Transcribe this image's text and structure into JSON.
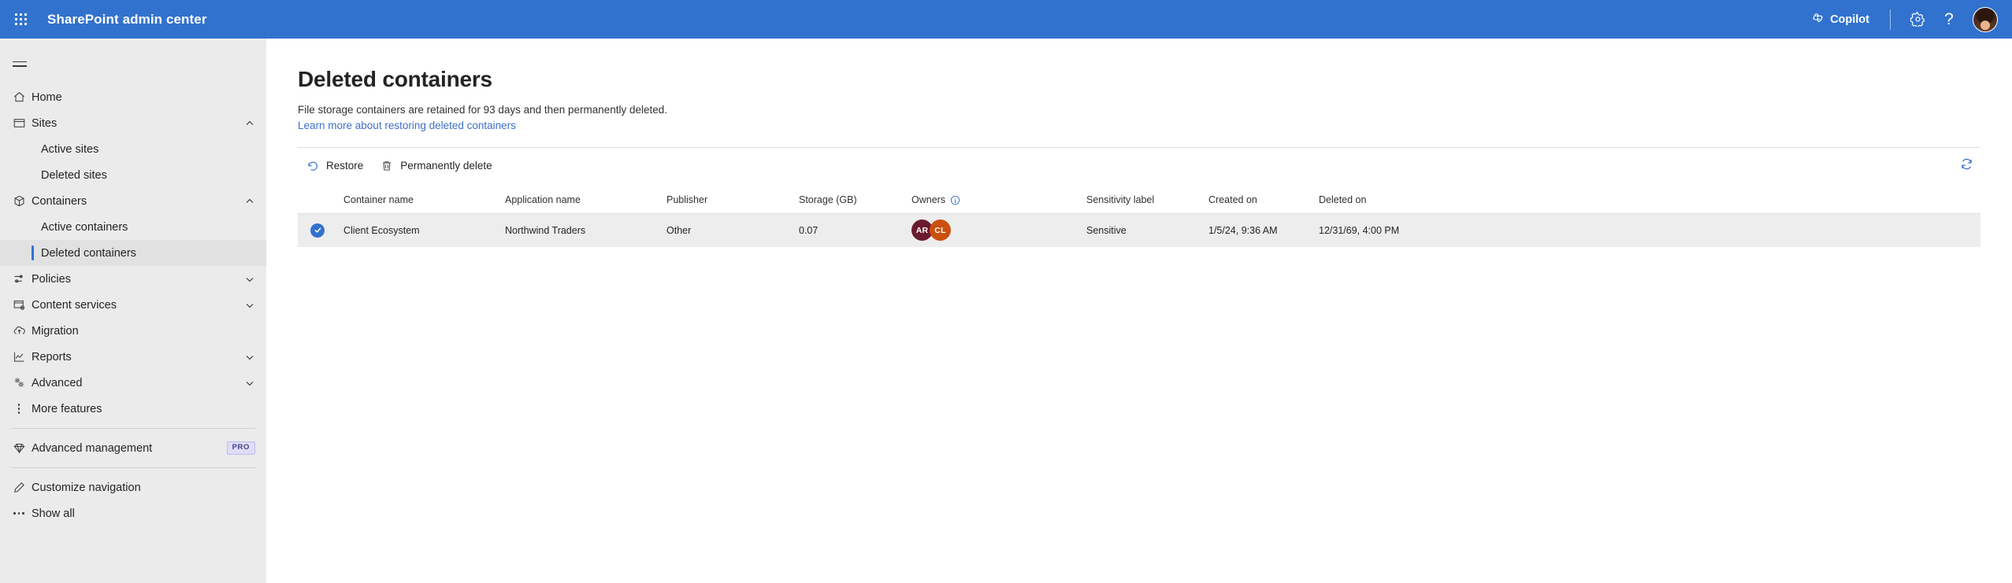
{
  "topbar": {
    "waffle_icon": "app-launcher-icon",
    "brand": "SharePoint admin center",
    "copilot_label": "Copilot",
    "copilot_icon": "copilot-icon",
    "settings_icon": "gear-icon",
    "help_icon": "question-mark-icon",
    "help_glyph": "?",
    "avatar_icon": "user-avatar",
    "accent_color": "#3172ce"
  },
  "sidebar": {
    "menu_icon": "hamburger-menu-icon",
    "items": [
      {
        "label": "Home",
        "icon": "home-icon",
        "type": "item",
        "expandable": false
      },
      {
        "label": "Sites",
        "icon": "sites-icon",
        "type": "item",
        "expandable": true,
        "expanded": true,
        "chevron": "chevron-up-icon"
      },
      {
        "label": "Active sites",
        "type": "sub",
        "selected": false
      },
      {
        "label": "Deleted sites",
        "type": "sub",
        "selected": false
      },
      {
        "label": "Containers",
        "icon": "container-box-icon",
        "type": "item",
        "expandable": true,
        "expanded": true,
        "chevron": "chevron-up-icon"
      },
      {
        "label": "Active containers",
        "type": "sub",
        "selected": false
      },
      {
        "label": "Deleted containers",
        "type": "sub",
        "selected": true
      },
      {
        "label": "Policies",
        "icon": "sliders-icon",
        "type": "item",
        "expandable": true,
        "expanded": false,
        "chevron": "chevron-down-icon"
      },
      {
        "label": "Content services",
        "icon": "content-services-icon",
        "type": "item",
        "expandable": true,
        "expanded": false,
        "chevron": "chevron-down-icon"
      },
      {
        "label": "Migration",
        "icon": "cloud-upload-icon",
        "type": "item",
        "expandable": false
      },
      {
        "label": "Reports",
        "icon": "reports-chart-icon",
        "type": "item",
        "expandable": true,
        "expanded": false,
        "chevron": "chevron-down-icon"
      },
      {
        "label": "Advanced",
        "icon": "advanced-gears-icon",
        "type": "item",
        "expandable": true,
        "expanded": false,
        "chevron": "chevron-down-icon"
      },
      {
        "label": "More features",
        "icon": "more-vertical-dots-icon",
        "type": "item",
        "expandable": false
      },
      {
        "label": "Advanced management",
        "icon": "diamond-icon",
        "type": "item",
        "expandable": false,
        "badge": "PRO"
      },
      {
        "label": "Customize navigation",
        "icon": "pencil-edit-icon",
        "type": "item",
        "expandable": false
      },
      {
        "label": "Show all",
        "icon": "more-horizontal-dots-icon",
        "type": "item",
        "expandable": false
      }
    ]
  },
  "main": {
    "title": "Deleted containers",
    "description": "File storage containers are retained for 93 days and then permanently deleted.",
    "link": "Learn more about restoring deleted containers",
    "commands": [
      {
        "label": "Restore",
        "icon": "restore-arrow-icon"
      },
      {
        "label": "Permanently delete",
        "icon": "trash-delete-icon"
      }
    ],
    "refresh_icon": "refresh-icon",
    "table": {
      "columns": [
        "Container name",
        "Application name",
        "Publisher",
        "Storage (GB)",
        "Owners",
        "Sensitivity label",
        "Created on",
        "Deleted on"
      ],
      "owners_info_icon": "info-circle-icon",
      "rows": [
        {
          "selected": true,
          "select_icon": "checkmark-circle-icon",
          "container_name": "Client Ecosystem",
          "application_name": "Northwind Traders",
          "publisher": "Other",
          "storage_gb": "0.07",
          "owners": [
            {
              "initials": "AR",
              "color": "#6b1a2e"
            },
            {
              "initials": "CL",
              "color": "#ca5010"
            }
          ],
          "sensitivity_label": "Sensitive",
          "created_on": "1/5/24, 9:36 AM",
          "deleted_on": "12/31/69, 4:00 PM"
        }
      ]
    }
  }
}
